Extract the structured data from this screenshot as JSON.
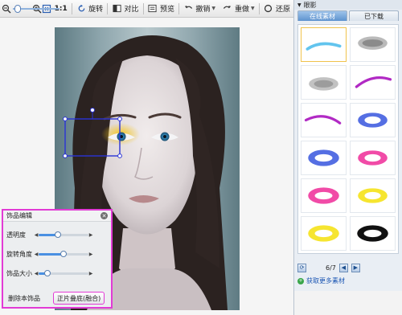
{
  "toolbar": {
    "ratio_label": "1:1",
    "rotate_label": "旋转",
    "compare_label": "对比",
    "preview_label": "预览",
    "undo_label": "撤销",
    "redo_label": "重做",
    "restore_label": "还原"
  },
  "right_panel": {
    "header": "眼影",
    "tabs": [
      {
        "label": "在线素材",
        "active": true
      },
      {
        "label": "已下载",
        "active": false
      }
    ],
    "page": "6/7",
    "more_link": "获取更多素材"
  },
  "edit_panel": {
    "title": "饰品编辑",
    "rows": [
      {
        "label": "透明度",
        "value": "",
        "level": 0.38
      },
      {
        "label": "旋转角度",
        "value": "",
        "level": 0.5
      },
      {
        "label": "饰品大小",
        "value": "",
        "level": 0.18
      }
    ],
    "delete_label": "删除本饰品",
    "blend_label": "正片叠底(融合)"
  },
  "colors": {
    "accent_magenta": "#e23bd5",
    "selection_blue": "#2a33d6",
    "tab_blue": "#5e93cf"
  }
}
